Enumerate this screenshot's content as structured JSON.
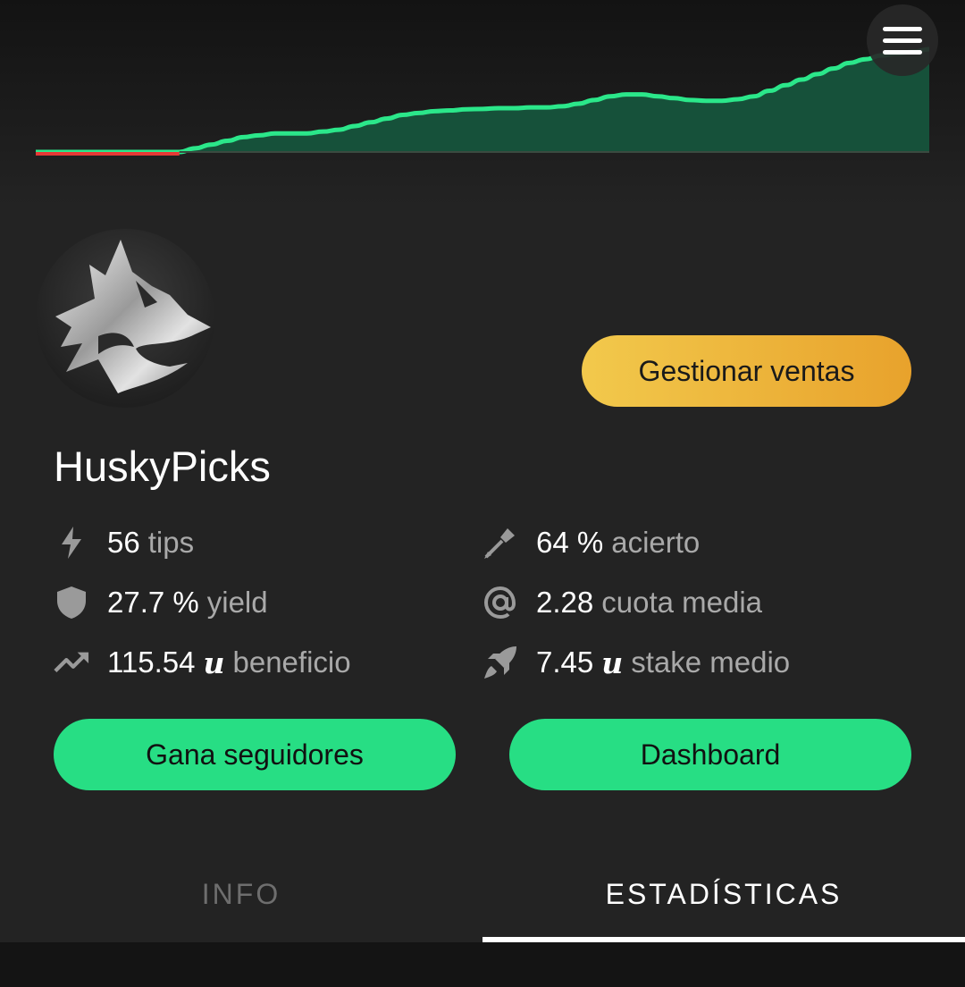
{
  "chart_data": {
    "type": "area",
    "x": [
      0,
      1,
      2,
      3,
      4,
      5,
      6,
      7,
      8,
      9,
      10,
      11,
      12,
      13,
      14,
      15,
      16,
      17,
      18,
      19,
      20,
      21,
      22,
      23,
      24,
      25,
      26,
      27,
      28,
      29,
      30,
      31,
      32,
      33,
      34,
      35,
      36,
      37,
      38,
      39,
      40,
      41,
      42,
      43,
      44,
      45,
      46,
      47,
      48,
      49,
      50,
      51,
      52,
      53,
      54,
      55,
      56
    ],
    "values": [
      0,
      0,
      0,
      0,
      0,
      0,
      0,
      0,
      0,
      0,
      1,
      2,
      3,
      4,
      4.5,
      5,
      5,
      5,
      5.5,
      6,
      7,
      8,
      9,
      10,
      10.5,
      11,
      11.2,
      11.5,
      11.6,
      11.8,
      11.8,
      12,
      12,
      12.3,
      13,
      14,
      15,
      15.5,
      15.5,
      15,
      14.5,
      14,
      13.8,
      13.8,
      14.2,
      15,
      16.5,
      18,
      19.5,
      21,
      22.5,
      24,
      25,
      26,
      26.5,
      27,
      27.7
    ],
    "negative_segment_color": "#e53935",
    "line_color": "#2be78a",
    "fill_color": "#16513a"
  },
  "header": {
    "menu_icon": "menu-icon"
  },
  "profile": {
    "avatar_icon": "husky-logo-icon",
    "username": "HuskyPicks",
    "manage_sales_label": "Gestionar ventas"
  },
  "stats": {
    "tips": {
      "icon": "bolt-icon",
      "value": "56",
      "label": "tips"
    },
    "yield": {
      "icon": "shield-icon",
      "value": "27.7 %",
      "label": "yield"
    },
    "profit": {
      "icon": "trending-up-icon",
      "value": "115.54",
      "unit": "u",
      "label": "beneficio"
    },
    "hit": {
      "icon": "dart-icon",
      "value": "64 %",
      "label": "acierto"
    },
    "odds": {
      "icon": "at-icon",
      "value": "2.28",
      "label": "cuota media"
    },
    "stake": {
      "icon": "rocket-icon",
      "value": "7.45",
      "unit": "u",
      "label": "stake medio"
    }
  },
  "actions": {
    "followers_label": "Gana seguidores",
    "dashboard_label": "Dashboard"
  },
  "tabs": [
    {
      "label": "INFO",
      "active": false,
      "color": "#6e6e6e"
    },
    {
      "label": "ESTADÍSTICAS",
      "active": true,
      "color": "#ffffff"
    }
  ],
  "colors": {
    "accent_green": "#27de84",
    "accent_gold": "#f2c94c",
    "background": "#232323"
  }
}
